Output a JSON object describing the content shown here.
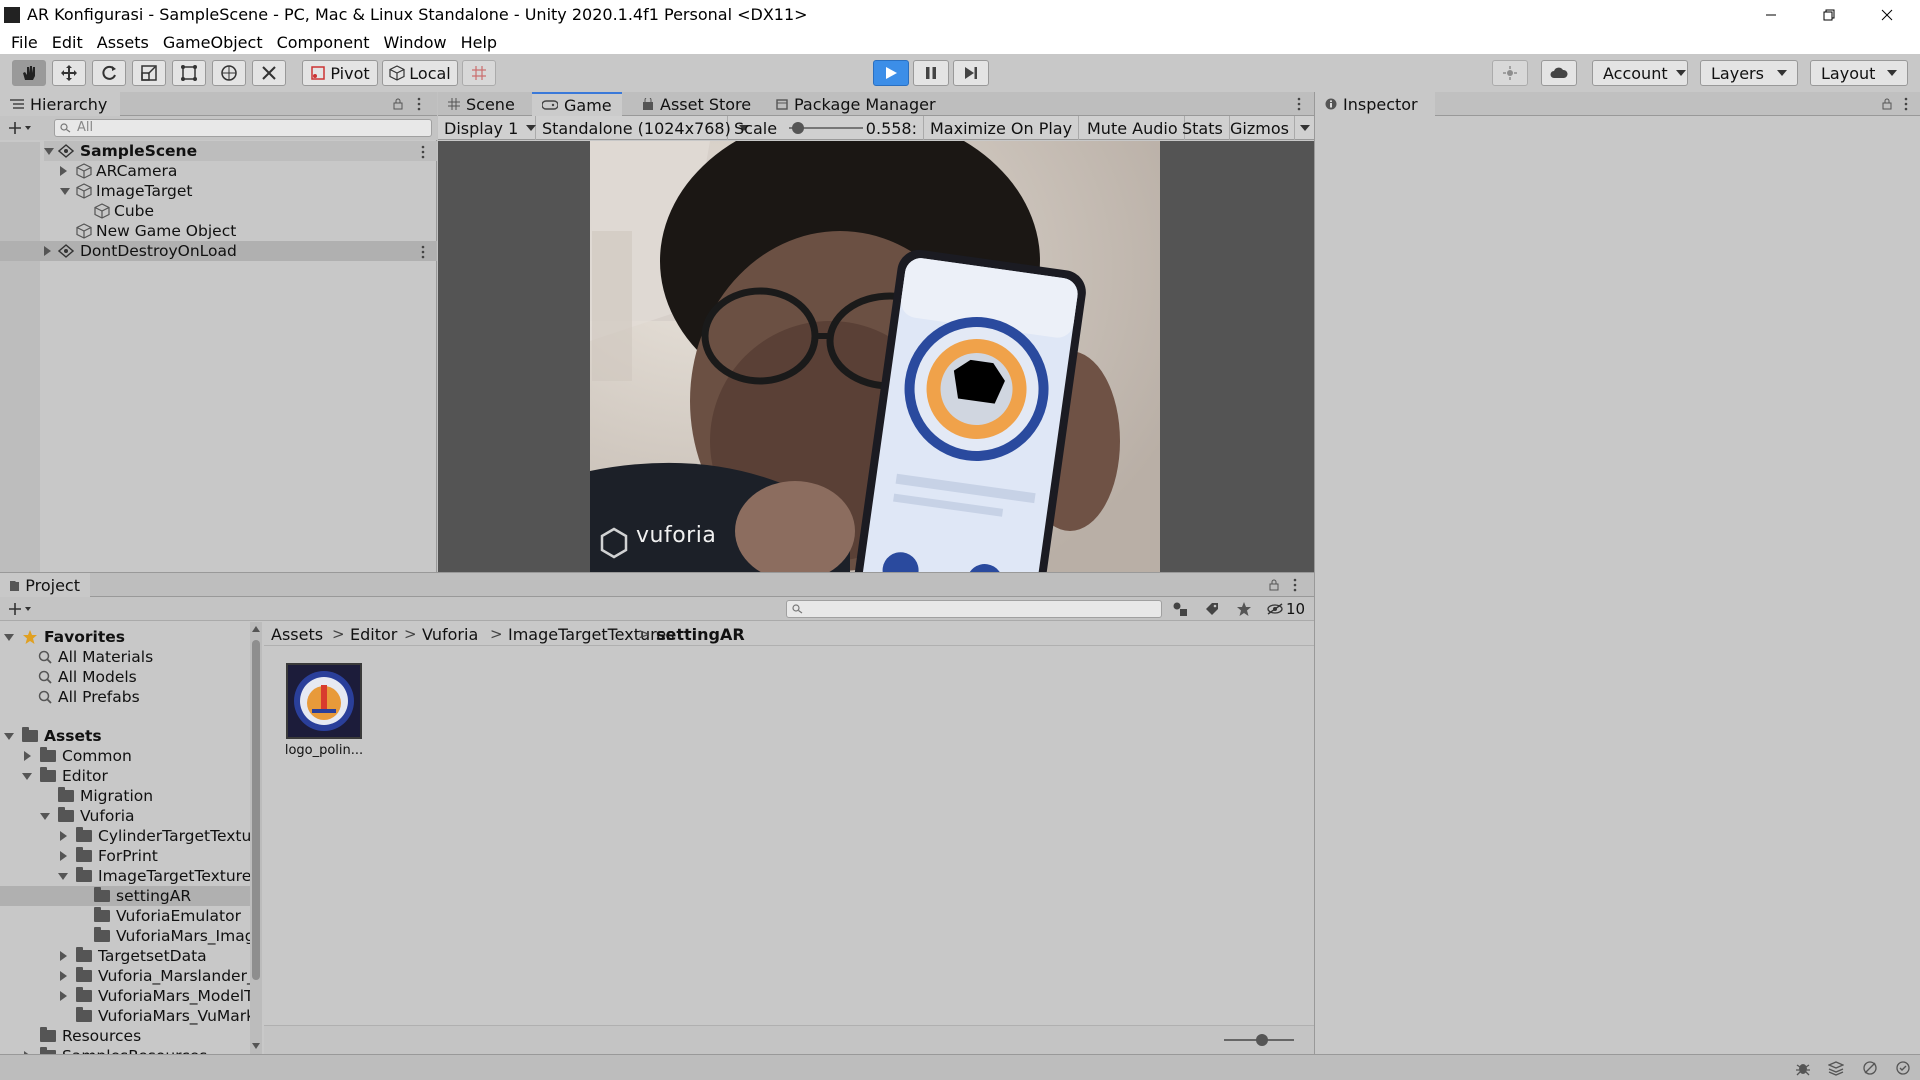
{
  "window": {
    "title": "AR Konfigurasi - SampleScene - PC, Mac & Linux Standalone - Unity 2020.1.4f1 Personal <DX11>"
  },
  "menu": [
    "File",
    "Edit",
    "Assets",
    "GameObject",
    "Component",
    "Window",
    "Help"
  ],
  "toolbar": {
    "pivot_label": "Pivot",
    "local_label": "Local",
    "account_label": "Account",
    "layers_label": "Layers",
    "layout_label": "Layout"
  },
  "hierarchy": {
    "tab_label": "Hierarchy",
    "search_placeholder": "All",
    "rows": [
      {
        "label": "SampleScene"
      },
      {
        "label": "ARCamera"
      },
      {
        "label": "ImageTarget"
      },
      {
        "label": "Cube"
      },
      {
        "label": "New Game Object"
      },
      {
        "label": "DontDestroyOnLoad"
      }
    ]
  },
  "game": {
    "tabs": [
      "Scene",
      "Game",
      "Asset Store",
      "Package Manager"
    ],
    "display": "Display 1",
    "resolution": "Standalone (1024x768)",
    "scale_label": "Scale",
    "scale_value": "0.558:",
    "scale_fraction": 0.05,
    "maximize": "Maximize On Play",
    "mute": "Mute Audio",
    "stats": "Stats",
    "gizmos": "Gizmos",
    "watermark": "vuforia"
  },
  "inspector": {
    "tab_label": "Inspector"
  },
  "project": {
    "tab_label": "Project",
    "hidden_count": "10",
    "favorites_label": "Favorites",
    "favorites": [
      "All Materials",
      "All Models",
      "All Prefabs"
    ],
    "assets_label": "Assets",
    "tree": [
      {
        "label": "Common"
      },
      {
        "label": "Editor"
      },
      {
        "label": "Migration"
      },
      {
        "label": "Vuforia"
      },
      {
        "label": "CylinderTargetTextur"
      },
      {
        "label": "ForPrint"
      },
      {
        "label": "ImageTargetTextures"
      },
      {
        "label": "settingAR"
      },
      {
        "label": "VuforiaEmulator"
      },
      {
        "label": "VuforiaMars_Image"
      },
      {
        "label": "TargetsetData"
      },
      {
        "label": "Vuforia_Marslander_R"
      },
      {
        "label": "VuforiaMars_ModelTa"
      },
      {
        "label": "VuforiaMars_VuMark"
      },
      {
        "label": "Resources"
      },
      {
        "label": "SamplesResources"
      }
    ],
    "breadcrumb": [
      "Assets",
      "Editor",
      "Vuforia",
      "ImageTargetTextures",
      "settingAR"
    ],
    "asset_label": "logo_polin..."
  },
  "colors": {
    "accent": "#3a79d9",
    "play_button": "#3c8ee8",
    "panel_bg": "#c8c8c8",
    "selected_row": "#b0b0b0"
  }
}
